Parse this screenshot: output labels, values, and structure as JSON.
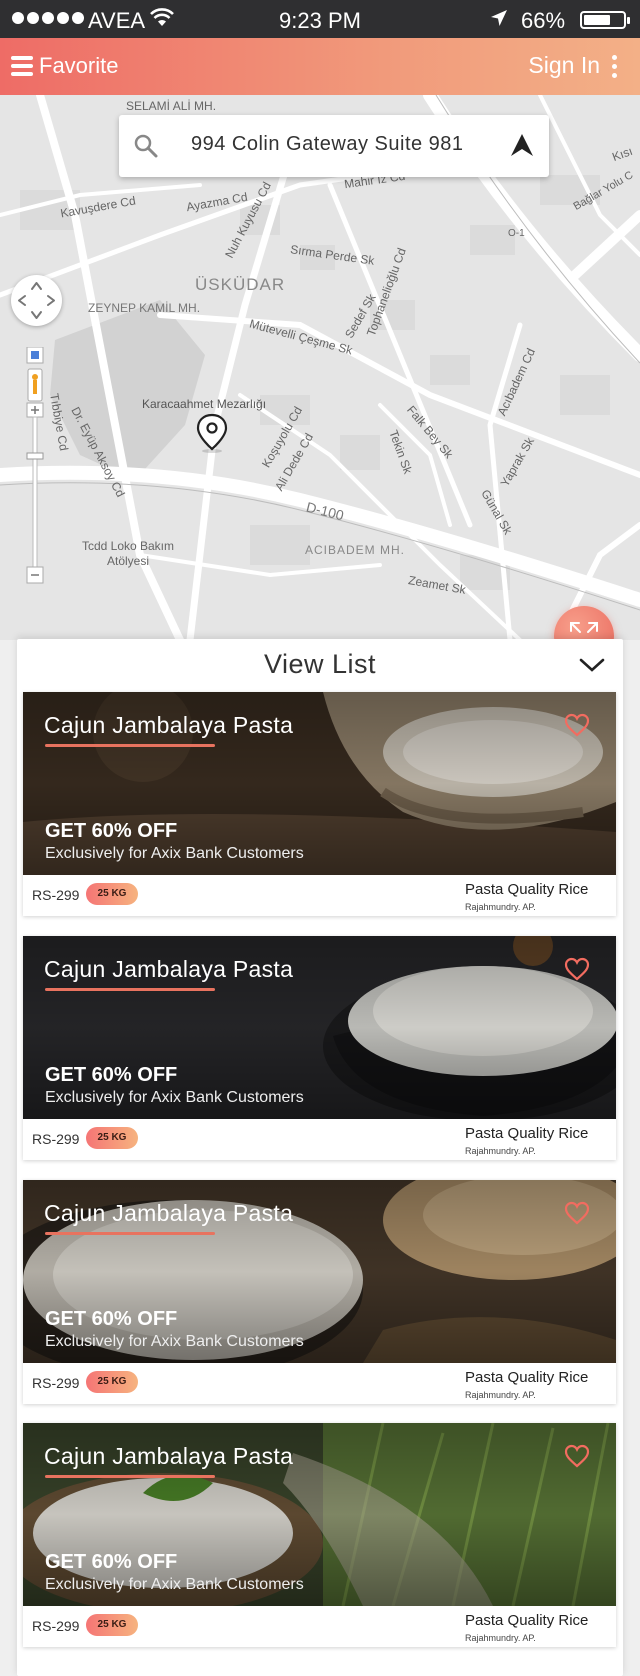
{
  "status_bar": {
    "carrier": "AVEA",
    "time": "9:23 PM",
    "battery": "66%"
  },
  "app_bar": {
    "title": "Favorite",
    "sign_in": "Sign In"
  },
  "search": {
    "value": "994 Colin Gateway Suite 981"
  },
  "map": {
    "labels": {
      "selami": "SELAMİ ALİ MH.",
      "ayazma": "Ayazma Cd",
      "kavusdere": "Kavuşdere Cd",
      "mahir": "Mahir İz Cd",
      "uskudar": "ÜSKÜDAR",
      "nuh": "Nuh Kuyusu Cd",
      "sirma": "Sırma Perde Sk",
      "tophane": "Tophanelioğlu Cd",
      "zeynep": "ZEYNEP KAMİL MH.",
      "mutevelli": "Mütevelli Çeşme Sk",
      "sedef": "Sedef Sk",
      "karaca": "Karacaahmet Mezarlığı",
      "eyup": "Dr. Eyüp Aksoy Cd",
      "tibbiye": "Tıbbiye Cd",
      "kosuyolu": "Koşuyolu Cd",
      "alidede": "Ali Dede Cd",
      "tekin": "Tekin Sk",
      "falkbey": "Falk Bey Sk",
      "acibadem_cd": "Acıbadem Cd",
      "yaprak": "Yaprak Sk",
      "gunal": "Günal Sk",
      "d100": "D-100",
      "acibadem_mh": "ACIBADEM MH.",
      "tcdd": "Tcdd Loko Bakım Atölyesi",
      "zeamet": "Zeamet Sk",
      "baglar": "Bağlar Yolu C",
      "kisikli": "Kısı",
      "o1": "O-1"
    }
  },
  "panel": {
    "title": "View List"
  },
  "cards": [
    {
      "title": "Cajun Jambalaya Pasta",
      "offer": "GET 60% OFF",
      "subtitle": "Exclusively for Axix Bank Customers",
      "price": "RS-299",
      "weight": "25 KG",
      "product": "Pasta Quality Rice",
      "location": "Rajahmundry. AP."
    },
    {
      "title": "Cajun Jambalaya Pasta",
      "offer": "GET 60% OFF",
      "subtitle": "Exclusively for Axix Bank Customers",
      "price": "RS-299",
      "weight": "25 KG",
      "product": "Pasta Quality Rice",
      "location": "Rajahmundry. AP."
    },
    {
      "title": "Cajun Jambalaya Pasta",
      "offer": "GET 60% OFF",
      "subtitle": "Exclusively for Axix Bank Customers",
      "price": "RS-299",
      "weight": "25 KG",
      "product": "Pasta Quality Rice",
      "location": "Rajahmundry. AP."
    },
    {
      "title": "Cajun Jambalaya Pasta",
      "offer": "GET 60% OFF",
      "subtitle": "Exclusively for Axix Bank Customers",
      "price": "RS-299",
      "weight": "25 KG",
      "product": "Pasta Quality Rice",
      "location": "Rajahmundry. AP."
    }
  ],
  "colors": {
    "accent": "#ee6c66",
    "accent_light": "#f3b087",
    "status_bar": "#2f2f31"
  },
  "icons": [
    "menu-icon",
    "kebab-icon",
    "search-icon",
    "navigate-icon",
    "pan-control-icon",
    "expand-icon",
    "location-pin-icon",
    "chevron-down-icon",
    "heart-icon"
  ]
}
